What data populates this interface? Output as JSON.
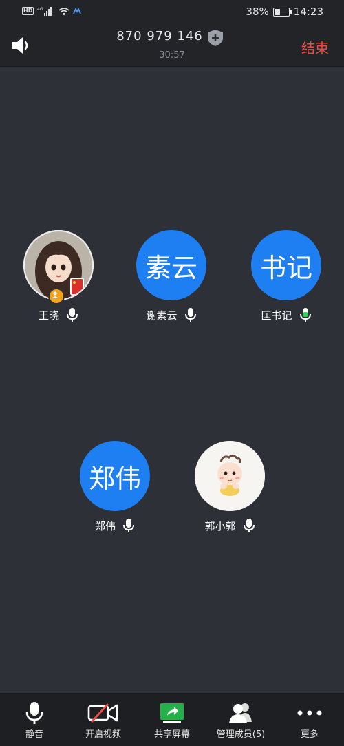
{
  "statusbar": {
    "network": "4G",
    "battery": "38%",
    "battery_level": 0.38,
    "time": "14:23"
  },
  "header": {
    "meeting_id": "870 979 146",
    "duration": "30:57",
    "end_label": "结束"
  },
  "participants": [
    {
      "name": "王晓",
      "avatar_text": "",
      "avatar_type": "photo-girl",
      "is_host": true,
      "mic": "on"
    },
    {
      "name": "谢素云",
      "avatar_text": "素云",
      "avatar_type": "text",
      "is_host": false,
      "mic": "on"
    },
    {
      "name": "匡书记",
      "avatar_text": "书记",
      "avatar_type": "text",
      "is_host": false,
      "mic": "speaking"
    },
    {
      "name": "郑伟",
      "avatar_text": "郑伟",
      "avatar_type": "text",
      "is_host": false,
      "mic": "on"
    },
    {
      "name": "郭小郭",
      "avatar_text": "",
      "avatar_type": "photo-baby",
      "is_host": false,
      "mic": "on"
    }
  ],
  "toolbar": {
    "mute_label": "静音",
    "video_label": "开启视频",
    "share_label": "共享屏幕",
    "members_label": "管理成员(5)",
    "more_label": "更多"
  },
  "colors": {
    "accent": "#1e7ff2",
    "end_red": "#f24a3e",
    "speaking_green": "#2fcf5a",
    "share_green": "#24b04a",
    "background": "#2d3137"
  }
}
